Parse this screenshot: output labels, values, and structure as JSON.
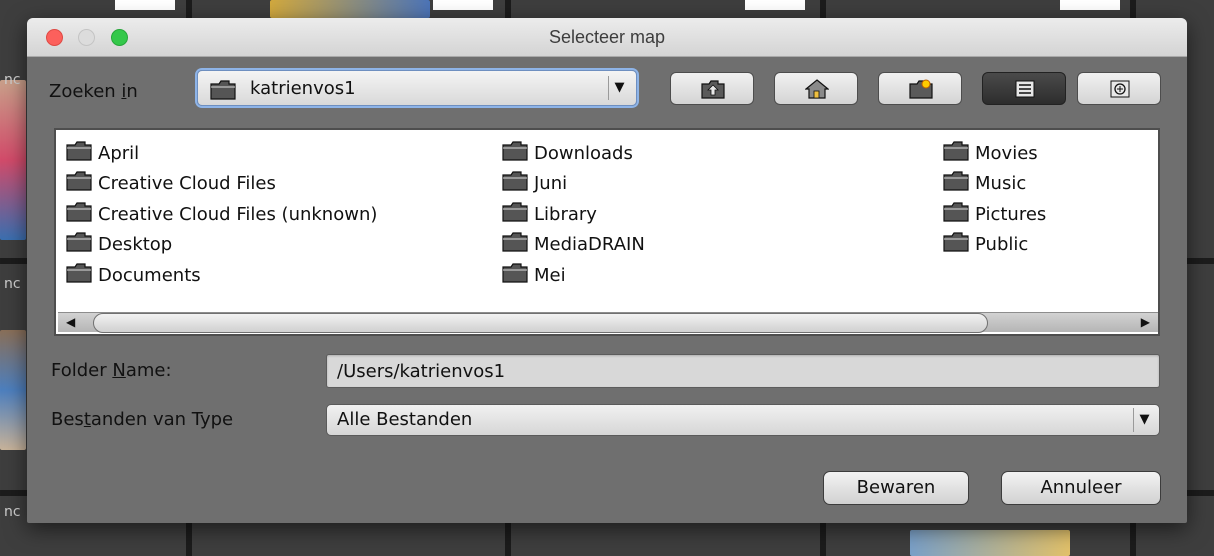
{
  "window": {
    "title": "Selecteer map"
  },
  "look_in": {
    "label_pre": "Zoeken ",
    "label_mnemonic": "i",
    "label_post": "n",
    "value": "katrienvos1"
  },
  "toolbar": {
    "buttons": [
      {
        "name": "up-one-level",
        "icon": "folder-up-icon"
      },
      {
        "name": "home",
        "icon": "home-icon"
      },
      {
        "name": "new-folder",
        "icon": "new-folder-icon"
      },
      {
        "name": "list-view",
        "icon": "list-view-icon",
        "active": true
      },
      {
        "name": "details-view",
        "icon": "details-view-icon"
      }
    ]
  },
  "files": {
    "columns": [
      [
        "April",
        "Creative Cloud Files",
        "Creative Cloud Files (unknown)",
        "Desktop",
        "Documents"
      ],
      [
        "Downloads",
        "Juni",
        "Library",
        "MediaDRAIN",
        "Mei"
      ],
      [
        "Movies",
        "Music",
        "Pictures",
        "Public"
      ]
    ]
  },
  "folder_name": {
    "label_pre": "Folder ",
    "label_mnemonic": "N",
    "label_post": "ame:",
    "value": "/Users/katrienvos1"
  },
  "file_type": {
    "label_pre": "Bes",
    "label_mnemonic": "t",
    "label_post": "anden van Type",
    "value": "Alle Bestanden"
  },
  "actions": {
    "save": "Bewaren",
    "cancel": "Annuleer"
  },
  "background": {
    "text_fragment": "nc"
  },
  "colors": {
    "dialog_bg": "#6f6f6f",
    "focus_ring": "#8eb4e8"
  }
}
